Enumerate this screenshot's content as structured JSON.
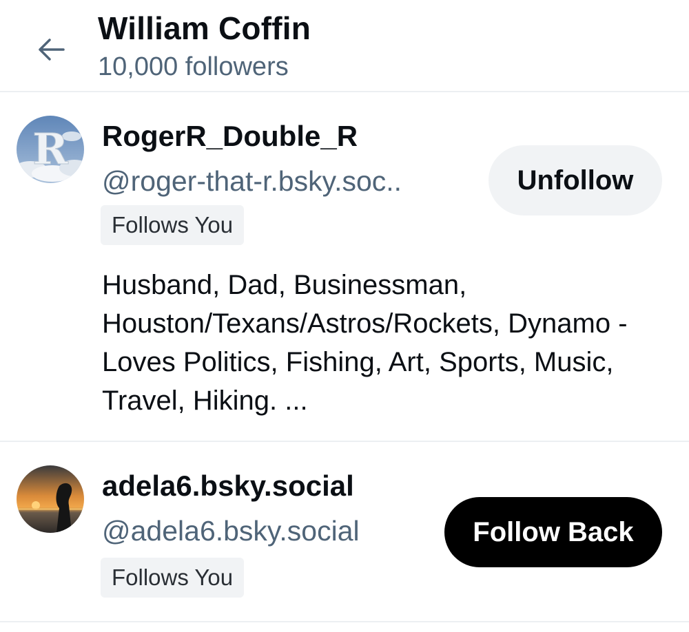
{
  "header": {
    "back_icon": "arrow-left-icon",
    "title": "William Coffin",
    "subtitle": "10,000 followers"
  },
  "followers": [
    {
      "display_name": "RogerR_Double_R",
      "handle": "@roger-that-r.bsky.soc..",
      "badge": "Follows You",
      "button_label": "Unfollow",
      "bio": "Husband, Dad, Businessman, Houston/Texans/Astros/Rockets, Dynamo - Loves Politics, Fishing, Art, Sports, Music, Travel, Hiking.  ..."
    },
    {
      "display_name": "adela6.bsky.social",
      "handle": "@adela6.bsky.social",
      "badge": "Follows You",
      "button_label": "Follow Back"
    }
  ],
  "colors": {
    "muted_text": "#4f6478",
    "divider": "#eceff2",
    "secondary_button_bg": "#f1f3f5",
    "primary_button_bg": "#000000"
  }
}
